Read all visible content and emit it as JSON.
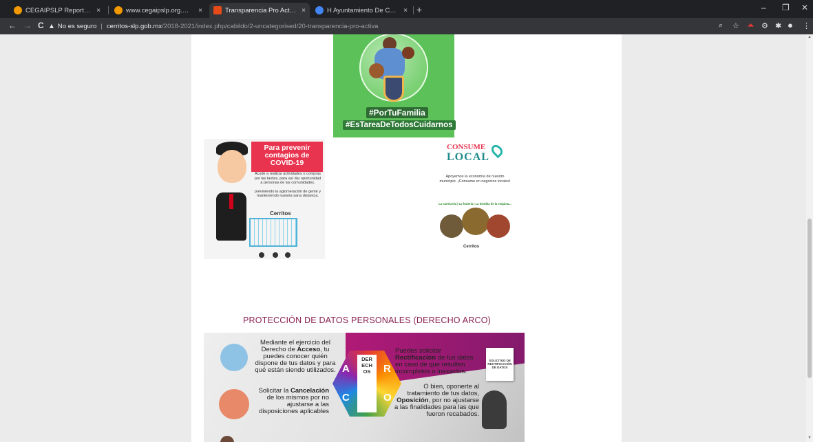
{
  "browser": {
    "tabs": [
      {
        "title": "CEGAIPSLP Reportes Mensuales",
        "favicon_color": "#f29900",
        "active": false
      },
      {
        "title": "www.cegaipslp.org.mx/webcegai",
        "favicon_color": "#f29900",
        "active": false
      },
      {
        "title": "Transparencia Pro Activa",
        "favicon_color": "#e64a19",
        "active": true
      },
      {
        "title": "H Ayuntamiento De Cerritos - Ini",
        "favicon_color": "#4285f4",
        "active": false
      }
    ],
    "tab_close": "×",
    "new_tab": "+",
    "window_controls": {
      "minimize": "–",
      "restore": "❐",
      "close": "✕"
    },
    "nav": {
      "back": "←",
      "forward": "→",
      "reload": "C"
    },
    "security_label": "No es seguro",
    "url_host": "cerritos-slp.gob.mx",
    "url_path": "/2018-2021/index.php/cabildo/2-uncategorised/20-transparencia-pro-activa",
    "icons": [
      "search-icon",
      "star-icon",
      "pdf-extension-icon",
      "extension-icon",
      "puzzle-icon",
      "profile-icon",
      "menu-icon"
    ]
  },
  "page": {
    "poster_family": {
      "hashtag_1": "#PorTuFamilia",
      "hashtag_2": "#EsTareaDeTodosCuidarnos"
    },
    "poster_covid": {
      "heading": "Para prevenir contagios de COVID-19",
      "body_1": "Acude a realizar actividades o compras por las tardes, para así dar oportunidad a personas de las comunidades.",
      "body_2": "previniendo la aglomeración de gente y manteniendo nuestra sana distancia.",
      "brand": "Cerritos"
    },
    "poster_local": {
      "title_1": "CONSUME",
      "title_2": "LOCAL",
      "text": "Apoyemos la economía de nuestro municipio. ¡Consume en negocios locales!",
      "green_text": "La carnicería | La frutería | La tiendita de la esquina...",
      "brand": "Cerritos"
    },
    "arco_section_title": "PROTECCIÓN DE DATOS PERSONALES (DERECHO ARCO)",
    "arco": {
      "access_pre": "Mediante el ejercicio del Derecho de ",
      "access_bold": "Acceso",
      "access_post": ", tu puedes conocer quién dispone de tus datos y para qué están siendo utilizados.",
      "rect_pre": "Puedes solicitar ",
      "rect_bold": "Rectificación",
      "rect_post": " de tus datos en caso de que resulten incompletos o inexactos.",
      "cancel_pre": "Solicitar la ",
      "cancel_bold": "Cancelación",
      "cancel_post": " de los mismos por no ajustarse a las disposiciones aplicables",
      "oppo_pre": "O bien, oponerte al tratamiento de tus datos, ",
      "oppo_bold": "Oposición",
      "oppo_post": ", por no ajustarse a las finalidades para las que fueron recabados.",
      "letters": [
        "A",
        "R",
        "C",
        "O"
      ],
      "derechos": "DERECHOS",
      "doc_label": "SOLICITUD DE RECTIFICACIÓN DE DATOS"
    }
  }
}
